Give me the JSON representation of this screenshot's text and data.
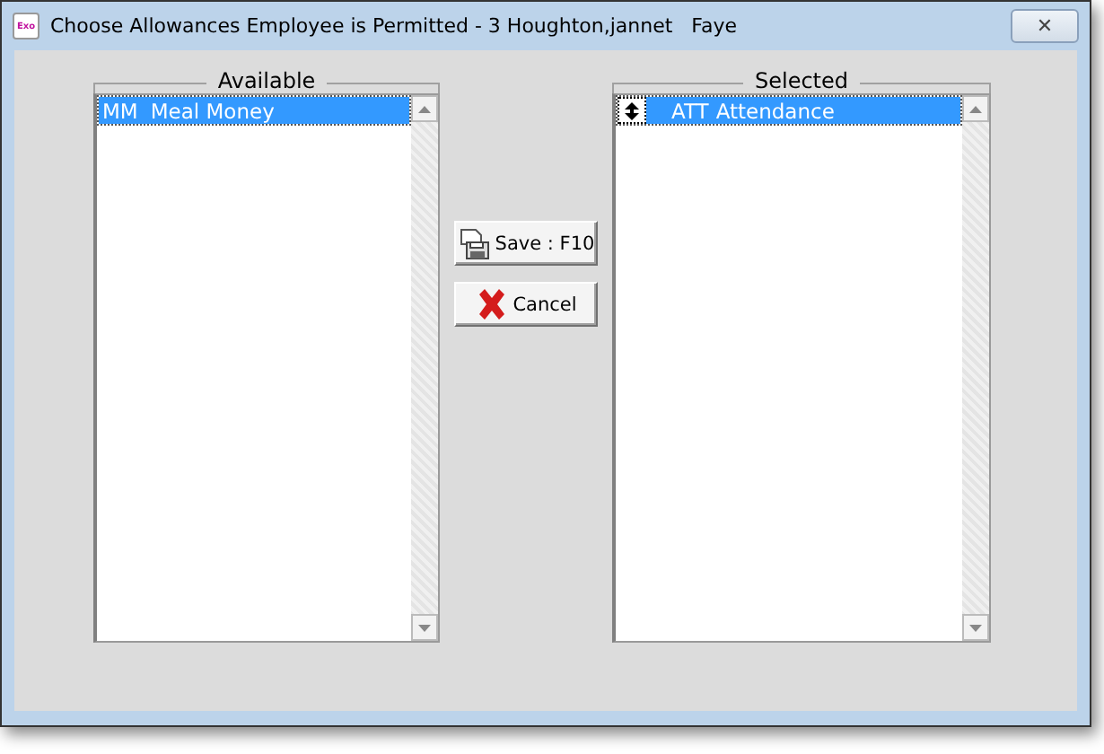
{
  "window": {
    "app_icon": "Exo",
    "title": "Choose Allowances Employee is Permitted - 3 Houghton,jannet   Faye",
    "close": "✕"
  },
  "lists": [
    {
      "title": "Available",
      "handle": false,
      "items": [
        {
          "code": "MM",
          "name": "Meal Money",
          "selected": true
        }
      ]
    },
    {
      "title": "Selected",
      "handle": true,
      "items": [
        {
          "code": "ATT",
          "name": "Attendance",
          "selected": true
        }
      ]
    }
  ],
  "buttons": [
    {
      "kind": "save",
      "label": "Save : F10"
    },
    {
      "kind": "cancel",
      "label": "Cancel"
    }
  ]
}
